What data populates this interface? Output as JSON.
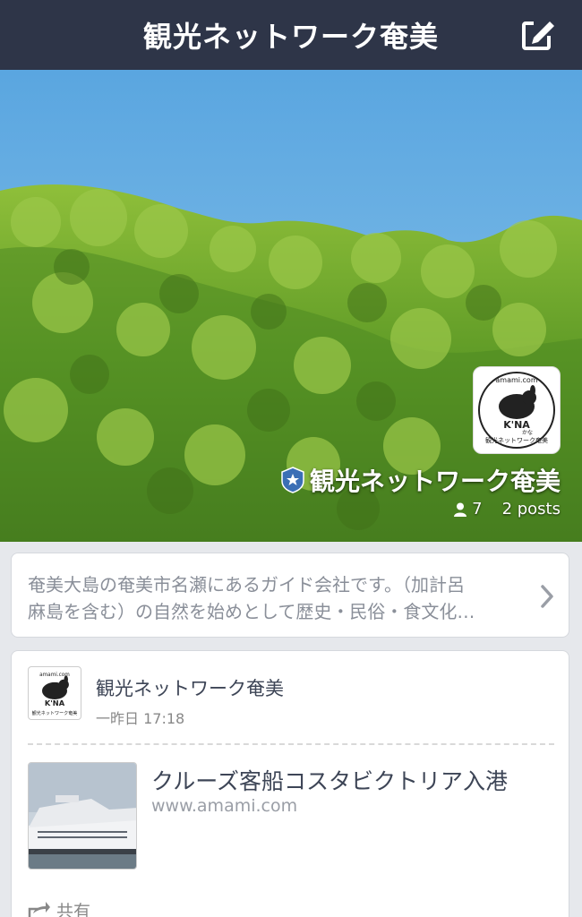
{
  "header": {
    "title": "観光ネットワーク奄美",
    "compose_icon": "compose-icon"
  },
  "cover": {
    "logo_top_text": "amami.com",
    "logo_main_text": "K'NA",
    "logo_small_text": "かな",
    "logo_bottom_text": "観光ネットワーク奄美",
    "group_name": "観光ネットワーク奄美",
    "members_count": "7",
    "posts_count": "2 posts"
  },
  "description": {
    "line1": "奄美大島の奄美市名瀬にあるガイド会社です。（加計呂",
    "line2": "麻島を含む）の自然を始めとして歴史・民俗・食文化…"
  },
  "post": {
    "author": "観光ネットワーク奄美",
    "time": "一昨日 17:18",
    "link_title": "クルーズ客船コスタビクトリア入港",
    "link_url": "www.amami.com",
    "share_label": "共有"
  },
  "colors": {
    "header_bg": "#2e3548",
    "page_bg": "#e6e8ec",
    "text_dark": "#3d4556",
    "text_muted": "#8a8f99"
  }
}
